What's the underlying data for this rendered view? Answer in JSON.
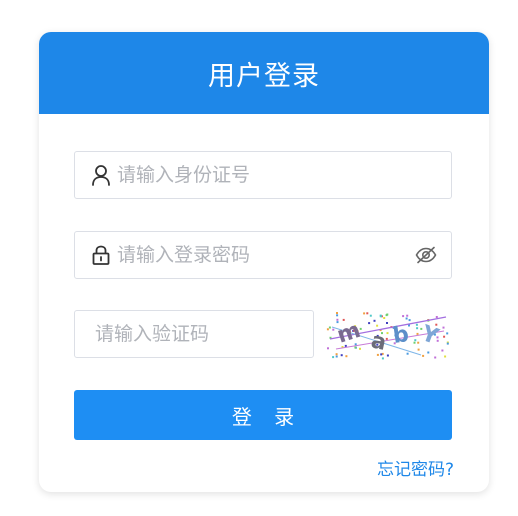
{
  "header": {
    "title": "用户登录",
    "color": "#1e87e8"
  },
  "form": {
    "username": {
      "placeholder": "请输入身份证号",
      "value": "",
      "icon": "user-icon"
    },
    "password": {
      "placeholder": "请输入登录密码",
      "value": "",
      "icon": "lock-icon",
      "toggle_icon": "eye-off-icon"
    },
    "captcha": {
      "placeholder": "请输入验证码",
      "value": "",
      "image_text": "mabY"
    },
    "submit_label": "登 录",
    "submit_color": "#1e8ef3",
    "forgot_label": "忘记密码?"
  }
}
